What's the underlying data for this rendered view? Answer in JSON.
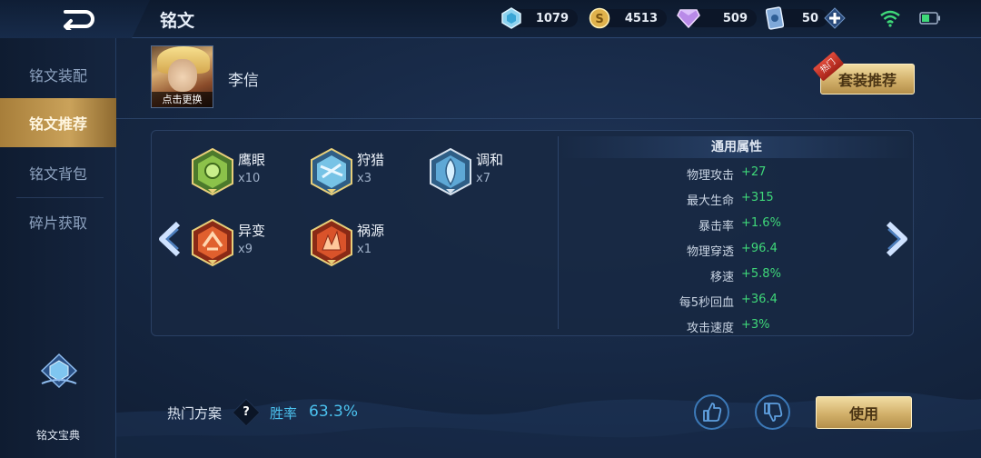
{
  "header": {
    "title": "铭文",
    "resources": [
      {
        "icon": "diamond-gem-icon",
        "value": "1079"
      },
      {
        "icon": "gold-coin-icon",
        "value": "4513"
      },
      {
        "icon": "purple-crystal-icon",
        "value": "509"
      },
      {
        "icon": "coupon-card-icon",
        "value": "50"
      }
    ]
  },
  "sidebar": {
    "items": [
      {
        "label": "铭文装配",
        "active": false
      },
      {
        "label": "铭文推荐",
        "active": true
      },
      {
        "label": "铭文背包",
        "active": false
      },
      {
        "label": "碎片获取",
        "active": false
      }
    ],
    "codex_label": "铭文宝典"
  },
  "hero": {
    "name": "李信",
    "change_caption": "点击更换"
  },
  "suit_button": {
    "label": "套装推荐",
    "tag": "热门"
  },
  "runes": [
    {
      "name": "鹰眼",
      "count": "x10",
      "color": "green"
    },
    {
      "name": "狩猎",
      "count": "x3",
      "color": "blue"
    },
    {
      "name": "调和",
      "count": "x7",
      "color": "blue"
    },
    {
      "name": "异变",
      "count": "x9",
      "color": "red"
    },
    {
      "name": "祸源",
      "count": "x1",
      "color": "red"
    }
  ],
  "attributes": {
    "title": "通用属性",
    "rows": [
      {
        "label": "物理攻击",
        "value": "+27"
      },
      {
        "label": "最大生命",
        "value": "+315"
      },
      {
        "label": "暴击率",
        "value": "+1.6%"
      },
      {
        "label": "物理穿透",
        "value": "+96.4"
      },
      {
        "label": "移速",
        "value": "+5.8%"
      },
      {
        "label": "每5秒回血",
        "value": "+36.4"
      },
      {
        "label": "攻击速度",
        "value": "+3%"
      }
    ]
  },
  "bottom": {
    "hot_plan_label": "热门方案",
    "help": "?",
    "winrate_label": "胜率",
    "winrate_value": "63.3%",
    "use_button": "使用"
  },
  "colors": {
    "accent_gold": "#d2b06a",
    "positive_green": "#3fd879",
    "winrate_blue": "#4cc3f0"
  }
}
